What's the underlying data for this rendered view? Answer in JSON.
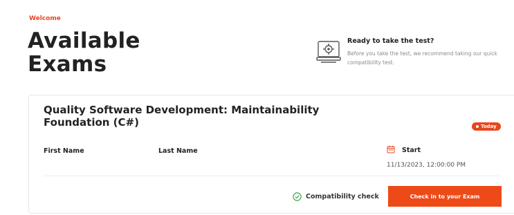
{
  "header": {
    "welcome": "Welcome",
    "title_line1": "Available",
    "title_line2": "Exams"
  },
  "ready": {
    "icon": "computer-gear-icon",
    "title": "Ready to take the test?",
    "description": "Before you take the test, we recommend taking our quick compatibility test."
  },
  "exam": {
    "title_line1": "Quality Software Development: Maintainability",
    "title_line2": "Foundation (C#)",
    "badge": "Today",
    "first_name_label": "First Name",
    "last_name_label": "Last Name",
    "start_label": "Start",
    "start_icon": "calendar-icon",
    "start_datetime": "11/13/2023, 12:00:00 PM",
    "compat_icon": "check-circle-icon",
    "compat_label": "Compatibility check",
    "checkin_label": "Check in to your Exam"
  },
  "colors": {
    "accent": "#ee4a18",
    "success": "#3fa34d"
  }
}
